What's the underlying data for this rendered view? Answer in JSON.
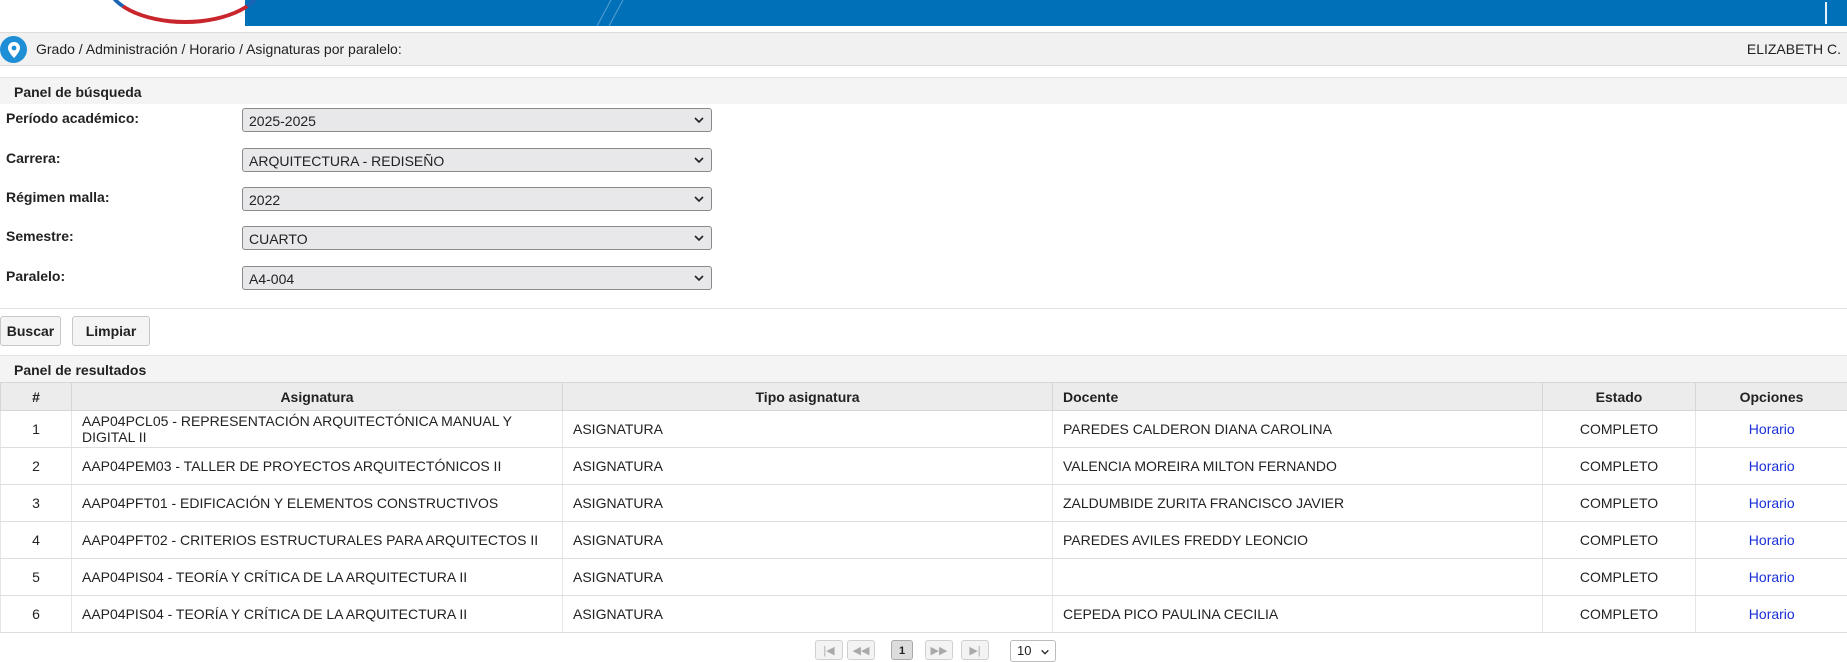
{
  "breadcrumb": "Grado / Administración / Horario / Asignaturas por paralelo:",
  "user": "ELIZABETH C.",
  "search_panel": {
    "title": "Panel de búsqueda",
    "fields": [
      {
        "label": "Período académico:",
        "value": "2025-2025"
      },
      {
        "label": "Carrera:",
        "value": "ARQUITECTURA - REDISEÑO"
      },
      {
        "label": "Régimen malla:",
        "value": "2022"
      },
      {
        "label": "Semestre:",
        "value": "CUARTO"
      },
      {
        "label": "Paralelo:",
        "value": "A4-004"
      }
    ],
    "buttons": {
      "search": "Buscar",
      "clear": "Limpiar"
    }
  },
  "results_panel": {
    "title": "Panel de resultados",
    "headers": [
      "#",
      "Asignatura",
      "Tipo asignatura",
      "Docente",
      "Estado",
      "Opciones"
    ],
    "rows": [
      {
        "num": "1",
        "subject": "AAP04PCL05 - REPRESENTACIÓN ARQUITECTÓNICA MANUAL Y DIGITAL II",
        "type": "ASIGNATURA",
        "teacher": "PAREDES CALDERON DIANA CAROLINA",
        "status": "COMPLETO",
        "option": "Horario"
      },
      {
        "num": "2",
        "subject": "AAP04PEM03 - TALLER DE PROYECTOS ARQUITECTÓNICOS II",
        "type": "ASIGNATURA",
        "teacher": "VALENCIA MOREIRA MILTON FERNANDO",
        "status": "COMPLETO",
        "option": "Horario"
      },
      {
        "num": "3",
        "subject": "AAP04PFT01 - EDIFICACIÓN Y ELEMENTOS CONSTRUCTIVOS",
        "type": "ASIGNATURA",
        "teacher": "ZALDUMBIDE ZURITA FRANCISCO JAVIER",
        "status": "COMPLETO",
        "option": "Horario"
      },
      {
        "num": "4",
        "subject": "AAP04PFT02 - CRITERIOS ESTRUCTURALES PARA ARQUITECTOS II",
        "type": "ASIGNATURA",
        "teacher": "PAREDES AVILES FREDDY LEONCIO",
        "status": "COMPLETO",
        "option": "Horario"
      },
      {
        "num": "5",
        "subject": "AAP04PIS04 - TEORÍA Y CRÍTICA DE LA ARQUITECTURA II",
        "type": "ASIGNATURA",
        "teacher": "",
        "status": "COMPLETO",
        "option": "Horario"
      },
      {
        "num": "6",
        "subject": "AAP04PIS04 - TEORÍA Y CRÍTICA DE LA ARQUITECTURA II",
        "type": "ASIGNATURA",
        "teacher": "CEPEDA PICO PAULINA CECILIA",
        "status": "COMPLETO",
        "option": "Horario"
      }
    ]
  },
  "pagination": {
    "first": "|◀",
    "prev": "◀◀",
    "current_page": "1",
    "next": "▶▶",
    "last": "▶|",
    "rows_per_page": "10"
  }
}
